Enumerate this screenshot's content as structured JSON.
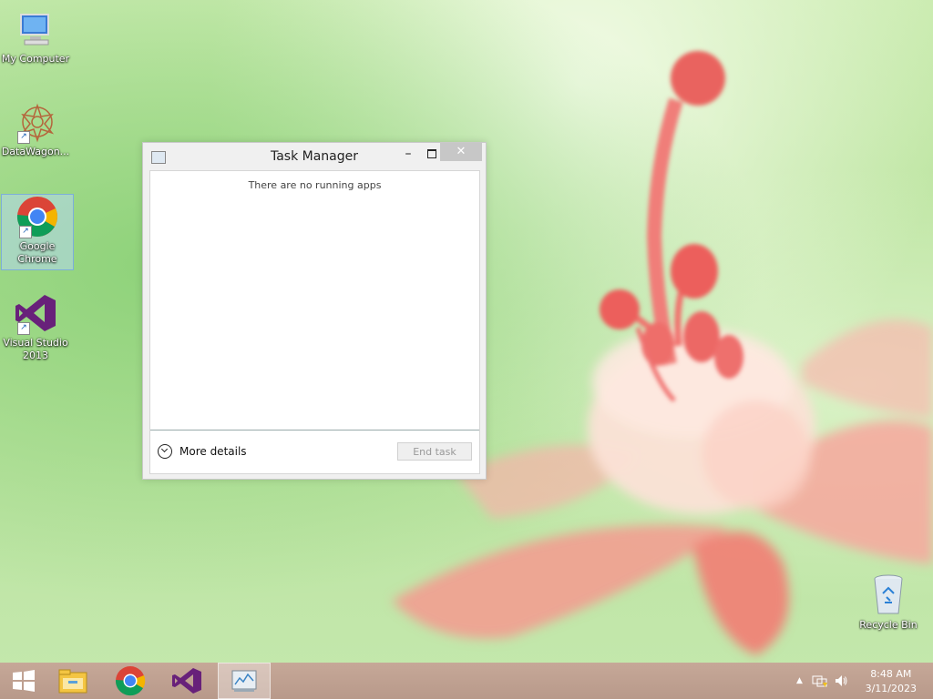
{
  "desktop": {
    "icons": [
      {
        "label": "My Computer",
        "icon": "computer-icon"
      },
      {
        "label": "DataWagon...",
        "icon": "datawagon-icon"
      },
      {
        "label": "Google Chrome",
        "icon": "chrome-icon"
      },
      {
        "label": "Visual Studio 2013",
        "icon": "visual-studio-icon"
      }
    ],
    "recycle_bin": {
      "label": "Recycle Bin",
      "icon": "recycle-bin-icon"
    }
  },
  "task_manager": {
    "title": "Task Manager",
    "minimize": "–",
    "close": "✕",
    "empty_message": "There are no running apps",
    "more_details": "More details",
    "end_task": "End task"
  },
  "taskbar": {
    "items": [
      "start-icon",
      "file-explorer-icon",
      "chrome-icon",
      "visual-studio-icon",
      "task-manager-icon"
    ],
    "tray_arrow": "▲",
    "time": "8:48 AM",
    "date": "3/11/2023"
  },
  "colors": {
    "taskbar": "#b8998a",
    "vs_purple": "#68217a",
    "close_button": "#c7c7c7"
  }
}
